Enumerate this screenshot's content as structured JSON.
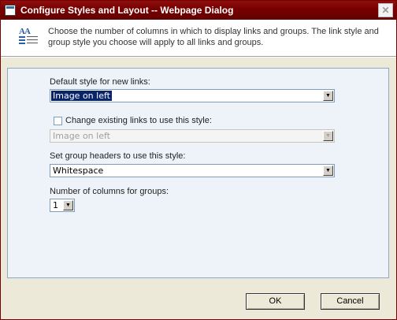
{
  "window": {
    "title": "Configure Styles and Layout -- Webpage Dialog",
    "close_glyph": "✕"
  },
  "description": {
    "text": "Choose the number of columns in which to display links and groups. The link style and group style you choose will apply to all links and groups.",
    "icon": "layout-styles-icon"
  },
  "form": {
    "default_style_label": "Default style for new links:",
    "default_style_value": "Image on left",
    "change_existing_label": "Change existing links to use this style:",
    "change_existing_checked": false,
    "change_existing_value": "Image on left",
    "group_header_label": "Set group headers to use this style:",
    "group_header_value": "Whitespace",
    "columns_label": "Number of columns for groups:",
    "columns_value": "1"
  },
  "buttons": {
    "ok_label": "OK",
    "cancel_label": "Cancel"
  },
  "colors": {
    "titlebar": "#7a0000",
    "panel_background": "#eef3fa",
    "panel_border": "#8fa8c8",
    "dialog_background": "#ece9d8"
  }
}
